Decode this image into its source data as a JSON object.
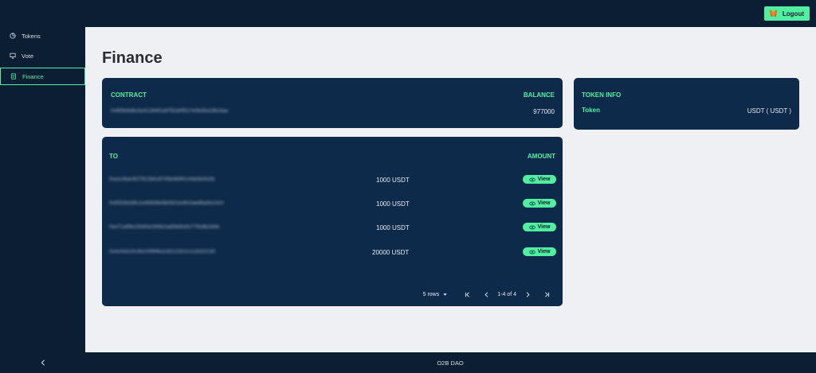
{
  "header": {
    "logout_label": "Logout"
  },
  "sidebar": {
    "items": [
      {
        "label": "Tokens",
        "icon": "pie-chart-icon",
        "active": false
      },
      {
        "label": "Vote",
        "icon": "monitor-icon",
        "active": false
      },
      {
        "label": "Finance",
        "icon": "receipt-icon",
        "active": true
      }
    ]
  },
  "main": {
    "title": "Finance"
  },
  "contract_card": {
    "contract_label": "CONTRACT",
    "balance_label": "BALANCE",
    "contract_address": "0x9f3b9d8c5e41264f2a9782d0f517e0b35a1f6c4aa",
    "balance": "977000"
  },
  "token_card": {
    "title": "TOKEN INFO",
    "token_label": "Token",
    "token_value": "USDT ( USDT )"
  },
  "transfers": {
    "to_label": "TO",
    "amount_label": "AMOUNT",
    "view_label": "View",
    "rows": [
      {
        "address": "0xa1c8de3f27912b0c8749e4b9f1c4de5e0e2b",
        "amount": "1000 USDT"
      },
      {
        "address": "0x5f32b0d9c1e4b5d9e9b0821e3fc0ae89a3e1410",
        "amount": "1000 USDT"
      },
      {
        "address": "0xe71af9bc05d0e19f4b2ad58d0ef1779c8b2d0b",
        "amount": "1000 USDT"
      },
      {
        "address": "0x4c0d2c0c3b2299f4b2c9212321c1c3222130",
        "amount": "20000 USDT"
      }
    ],
    "pagination": {
      "rows_label": "5 rows",
      "range": "1-4 of 4"
    }
  },
  "footer": {
    "label": "O2B DAO"
  },
  "colors": {
    "accent": "#51f0a0",
    "navy": "#0b1e33",
    "card": "#0e2a4a",
    "content_bg": "#eff0f4"
  }
}
